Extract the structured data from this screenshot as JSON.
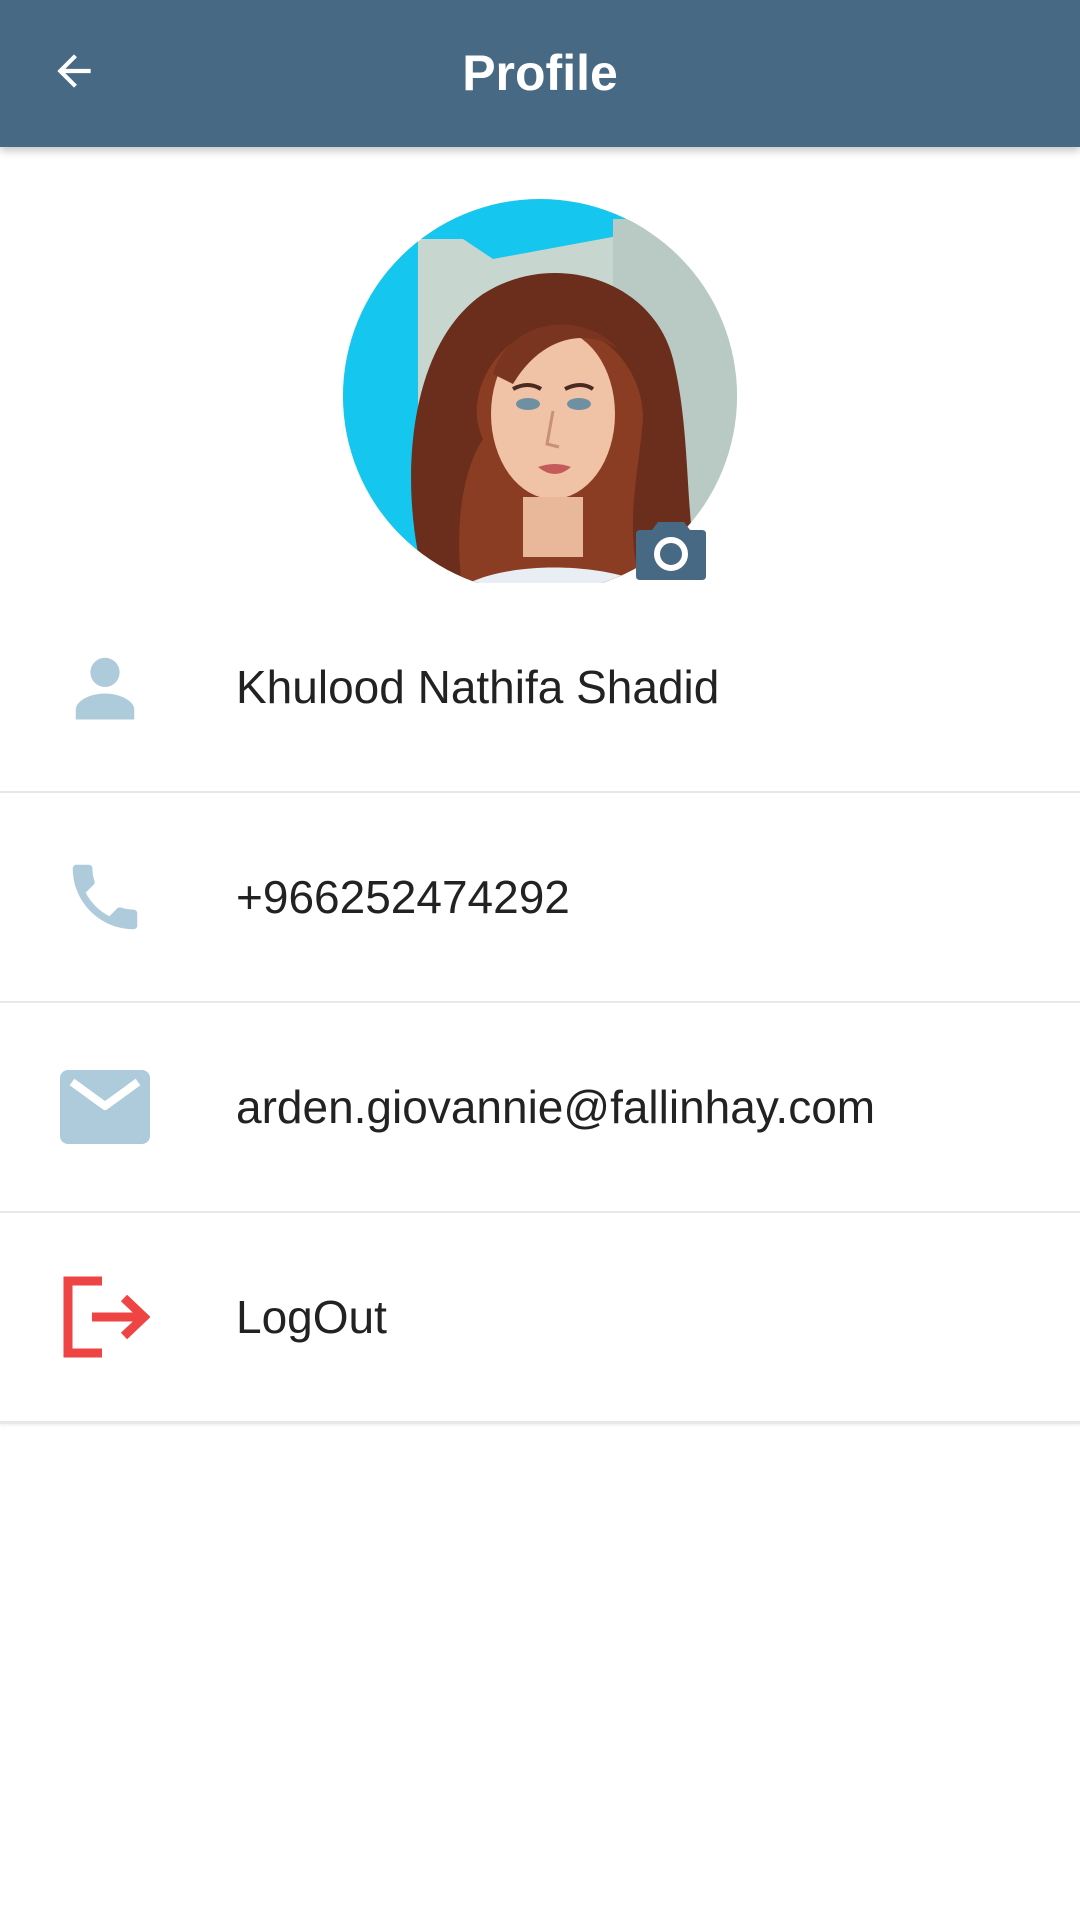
{
  "app_bar": {
    "title": "Profile",
    "back_icon": "arrow-left-icon",
    "background_color": "#476983"
  },
  "profile": {
    "avatar_alt": "Profile photo",
    "camera_icon": "camera-icon",
    "camera_color": "#476983"
  },
  "rows": [
    {
      "id": "name",
      "icon": "person-icon",
      "value": "Khulood Nathifa Shadid",
      "icon_color": "#aecbdc"
    },
    {
      "id": "phone",
      "icon": "phone-icon",
      "value": "+966252474292",
      "icon_color": "#aecbdc"
    },
    {
      "id": "email",
      "icon": "mail-icon",
      "value": "arden.giovannie@fallinhay.com",
      "icon_color": "#aecbdc"
    },
    {
      "id": "logout",
      "icon": "logout-icon",
      "value": "LogOut",
      "icon_color": "#ee4444"
    }
  ]
}
